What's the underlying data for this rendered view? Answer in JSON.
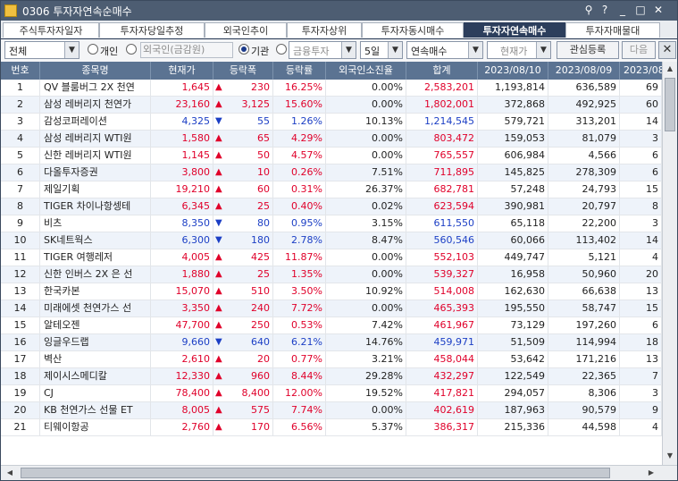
{
  "window": {
    "title": "0306 투자자연속순매수"
  },
  "titlebar_buttons": [
    "pin-icon",
    "help-icon",
    "minimize-icon",
    "restore-icon",
    "close-icon"
  ],
  "titlebar_glyphs": {
    "pin": "⚲",
    "help": "?",
    "minimize": "_",
    "restore": "□",
    "close": "✕"
  },
  "tabs": [
    {
      "label": "주식투자자일자"
    },
    {
      "label": "투자자당일추정"
    },
    {
      "label": "외국인추이"
    },
    {
      "label": "투자자상위"
    },
    {
      "label": "투자자동시매수"
    },
    {
      "label": "투자자연속매수",
      "active": true
    },
    {
      "label": "투자자매물대"
    }
  ],
  "filters": {
    "market": "전체",
    "radio_individual": "개인",
    "radio_foreign": "외국인(금감원)",
    "radio_institution": "기관",
    "institution_type": "금융투자",
    "period": "5일",
    "mode": "연속매수",
    "sort": "현재가",
    "watch_button": "관심등록",
    "next_button": "다음",
    "close_glyph": "✕"
  },
  "columns": [
    "번호",
    "종목명",
    "현재가",
    "등락폭",
    "등락률",
    "외국인소진율",
    "합계",
    "2023/08/10",
    "2023/08/09",
    "2023/08"
  ],
  "rows": [
    {
      "no": "1",
      "name": "QV 블룸버그 2X 천연",
      "price": "1,645",
      "dir": "up",
      "change": "230",
      "rate": "16.25%",
      "foreign": "0.00%",
      "total": "2,583,201",
      "d1": "1,193,814",
      "d2": "636,589",
      "d3": "69"
    },
    {
      "no": "2",
      "name": "삼성 레버리지 천연가",
      "price": "23,160",
      "dir": "up",
      "change": "3,125",
      "rate": "15.60%",
      "foreign": "0.00%",
      "total": "1,802,001",
      "d1": "372,868",
      "d2": "492,925",
      "d3": "60"
    },
    {
      "no": "3",
      "name": "감성코퍼레이션",
      "price": "4,325",
      "dir": "down",
      "change": "55",
      "rate": "1.26%",
      "foreign": "10.13%",
      "total": "1,214,545",
      "d1": "579,721",
      "d2": "313,201",
      "d3": "14"
    },
    {
      "no": "4",
      "name": "삼성 레버리지 WTI원",
      "price": "1,580",
      "dir": "up",
      "change": "65",
      "rate": "4.29%",
      "foreign": "0.00%",
      "total": "803,472",
      "d1": "159,053",
      "d2": "81,079",
      "d3": "3"
    },
    {
      "no": "5",
      "name": "신한 레버리지 WTI원",
      "price": "1,145",
      "dir": "up",
      "change": "50",
      "rate": "4.57%",
      "foreign": "0.00%",
      "total": "765,557",
      "d1": "606,984",
      "d2": "4,566",
      "d3": "6"
    },
    {
      "no": "6",
      "name": "다올투자증권",
      "price": "3,800",
      "dir": "up",
      "change": "10",
      "rate": "0.26%",
      "foreign": "7.51%",
      "total": "711,895",
      "d1": "145,825",
      "d2": "278,309",
      "d3": "6"
    },
    {
      "no": "7",
      "name": "제일기획",
      "price": "19,210",
      "dir": "up",
      "change": "60",
      "rate": "0.31%",
      "foreign": "26.37%",
      "total": "682,781",
      "d1": "57,248",
      "d2": "24,793",
      "d3": "15"
    },
    {
      "no": "8",
      "name": "TIGER 차이나항셍테",
      "price": "6,345",
      "dir": "up",
      "change": "25",
      "rate": "0.40%",
      "foreign": "0.02%",
      "total": "623,594",
      "d1": "390,981",
      "d2": "20,797",
      "d3": "8"
    },
    {
      "no": "9",
      "name": "비츠",
      "price": "8,350",
      "dir": "down",
      "change": "80",
      "rate": "0.95%",
      "foreign": "3.15%",
      "total": "611,550",
      "d1": "65,118",
      "d2": "22,200",
      "d3": "3"
    },
    {
      "no": "10",
      "name": "SK네트웍스",
      "price": "6,300",
      "dir": "down",
      "change": "180",
      "rate": "2.78%",
      "foreign": "8.47%",
      "total": "560,546",
      "d1": "60,066",
      "d2": "113,402",
      "d3": "14"
    },
    {
      "no": "11",
      "name": "TIGER 여행레저",
      "price": "4,005",
      "dir": "up",
      "change": "425",
      "rate": "11.87%",
      "foreign": "0.00%",
      "total": "552,103",
      "d1": "449,747",
      "d2": "5,121",
      "d3": "4"
    },
    {
      "no": "12",
      "name": "신한 인버스 2X 은 선",
      "price": "1,880",
      "dir": "up",
      "change": "25",
      "rate": "1.35%",
      "foreign": "0.00%",
      "total": "539,327",
      "d1": "16,958",
      "d2": "50,960",
      "d3": "20"
    },
    {
      "no": "13",
      "name": "한국카본",
      "price": "15,070",
      "dir": "up",
      "change": "510",
      "rate": "3.50%",
      "foreign": "10.92%",
      "total": "514,008",
      "d1": "162,630",
      "d2": "66,638",
      "d3": "13"
    },
    {
      "no": "14",
      "name": "미래에셋 천연가스 선",
      "price": "3,350",
      "dir": "up",
      "change": "240",
      "rate": "7.72%",
      "foreign": "0.00%",
      "total": "465,393",
      "d1": "195,550",
      "d2": "58,747",
      "d3": "15"
    },
    {
      "no": "15",
      "name": "알테오젠",
      "price": "47,700",
      "dir": "up",
      "change": "250",
      "rate": "0.53%",
      "foreign": "7.42%",
      "total": "461,967",
      "d1": "73,129",
      "d2": "197,260",
      "d3": "6"
    },
    {
      "no": "16",
      "name": "잉글우드랩",
      "price": "9,660",
      "dir": "down",
      "change": "640",
      "rate": "6.21%",
      "foreign": "14.76%",
      "total": "459,971",
      "d1": "51,509",
      "d2": "114,994",
      "d3": "18"
    },
    {
      "no": "17",
      "name": "벽산",
      "price": "2,610",
      "dir": "up",
      "change": "20",
      "rate": "0.77%",
      "foreign": "3.21%",
      "total": "458,044",
      "d1": "53,642",
      "d2": "171,216",
      "d3": "13"
    },
    {
      "no": "18",
      "name": "제이시스메디칼",
      "price": "12,330",
      "dir": "up",
      "change": "960",
      "rate": "8.44%",
      "foreign": "29.28%",
      "total": "432,297",
      "d1": "122,549",
      "d2": "22,365",
      "d3": "7"
    },
    {
      "no": "19",
      "name": "CJ",
      "price": "78,400",
      "dir": "up",
      "change": "8,400",
      "rate": "12.00%",
      "foreign": "19.52%",
      "total": "417,821",
      "d1": "294,057",
      "d2": "8,306",
      "d3": "3"
    },
    {
      "no": "20",
      "name": "KB 천연가스 선물 ET",
      "price": "8,005",
      "dir": "up",
      "change": "575",
      "rate": "7.74%",
      "foreign": "0.00%",
      "total": "402,619",
      "d1": "187,963",
      "d2": "90,579",
      "d3": "9"
    },
    {
      "no": "21",
      "name": "티웨이항공",
      "price": "2,760",
      "dir": "up",
      "change": "170",
      "rate": "6.56%",
      "foreign": "5.37%",
      "total": "386,317",
      "d1": "215,336",
      "d2": "44,598",
      "d3": "4"
    }
  ],
  "glyphs": {
    "up": "▲",
    "down": "▼",
    "scroll_up": "▲",
    "scroll_down": "▼",
    "scroll_left": "◀",
    "scroll_right": "▶",
    "dropdown": "▼"
  },
  "colors": {
    "up": "#e0002a",
    "down": "#1c3fc5",
    "header_bg": "#5b7392",
    "titlebar_bg": "#4d5d72",
    "active_tab": "#2c3e5c"
  }
}
